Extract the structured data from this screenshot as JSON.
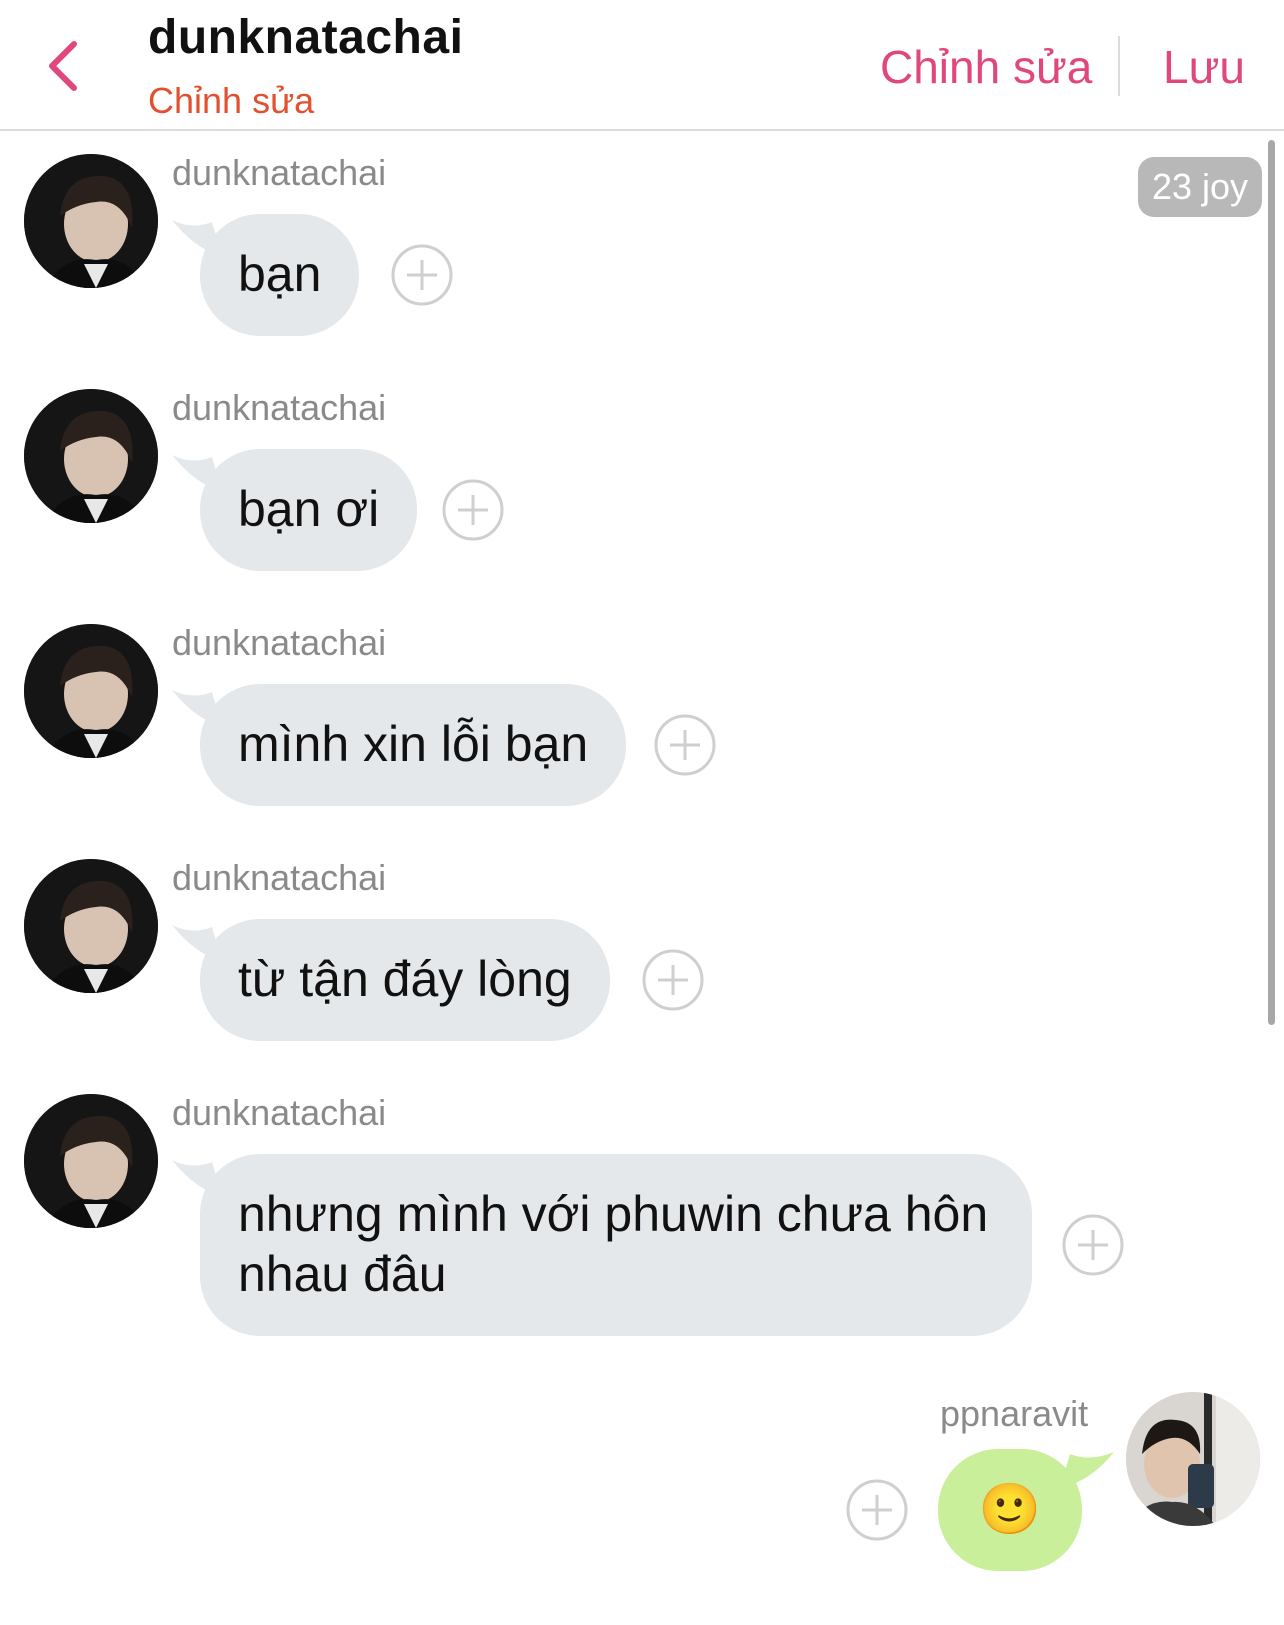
{
  "header": {
    "title": "dunknatachai",
    "subtitle": "Chỉnh sửa",
    "edit_label": "Chỉnh sửa",
    "save_label": "Lưu"
  },
  "badge": "23 joy",
  "messages": [
    {
      "sender": "dunknatachai",
      "text": "bạn"
    },
    {
      "sender": "dunknatachai",
      "text": "bạn ơi"
    },
    {
      "sender": "dunknatachai",
      "text": "mình xin lỗi bạn"
    },
    {
      "sender": "dunknatachai",
      "text": "từ tận đáy lòng"
    },
    {
      "sender": "dunknatachai",
      "text": "nhưng mình với phuwin chưa hôn nhau đâu"
    },
    {
      "sender": "ppnaravit",
      "text": "🙂"
    }
  ],
  "colors": {
    "accent_pink": "#e0487d",
    "subtitle_orange": "#e2512f",
    "incoming_bubble": "#e5e8eb",
    "outgoing_bubble": "#c9ef9b"
  },
  "icons": [
    "chevron-left-icon",
    "add-reaction-icon",
    "avatar"
  ]
}
